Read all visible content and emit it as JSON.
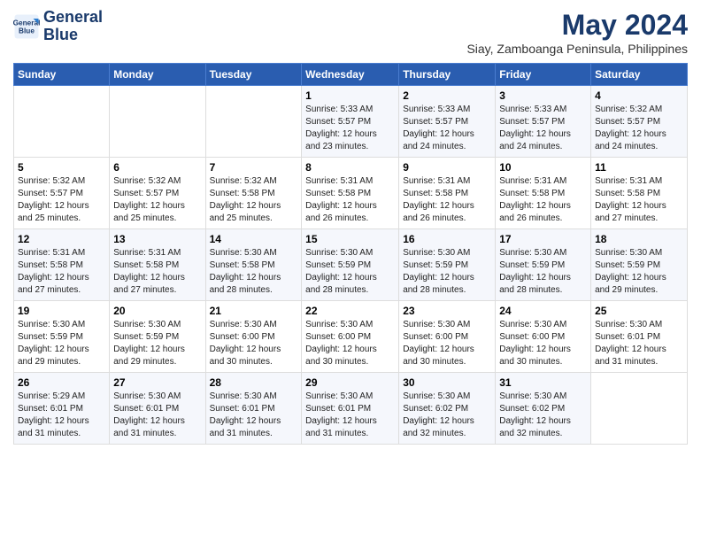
{
  "header": {
    "logo_line1": "General",
    "logo_line2": "Blue",
    "month_year": "May 2024",
    "location": "Siay, Zamboanga Peninsula, Philippines"
  },
  "days_of_week": [
    "Sunday",
    "Monday",
    "Tuesday",
    "Wednesday",
    "Thursday",
    "Friday",
    "Saturday"
  ],
  "weeks": [
    [
      {
        "day": "",
        "content": ""
      },
      {
        "day": "",
        "content": ""
      },
      {
        "day": "",
        "content": ""
      },
      {
        "day": "1",
        "content": "Sunrise: 5:33 AM\nSunset: 5:57 PM\nDaylight: 12 hours\nand 23 minutes."
      },
      {
        "day": "2",
        "content": "Sunrise: 5:33 AM\nSunset: 5:57 PM\nDaylight: 12 hours\nand 24 minutes."
      },
      {
        "day": "3",
        "content": "Sunrise: 5:33 AM\nSunset: 5:57 PM\nDaylight: 12 hours\nand 24 minutes."
      },
      {
        "day": "4",
        "content": "Sunrise: 5:32 AM\nSunset: 5:57 PM\nDaylight: 12 hours\nand 24 minutes."
      }
    ],
    [
      {
        "day": "5",
        "content": "Sunrise: 5:32 AM\nSunset: 5:57 PM\nDaylight: 12 hours\nand 25 minutes."
      },
      {
        "day": "6",
        "content": "Sunrise: 5:32 AM\nSunset: 5:57 PM\nDaylight: 12 hours\nand 25 minutes."
      },
      {
        "day": "7",
        "content": "Sunrise: 5:32 AM\nSunset: 5:58 PM\nDaylight: 12 hours\nand 25 minutes."
      },
      {
        "day": "8",
        "content": "Sunrise: 5:31 AM\nSunset: 5:58 PM\nDaylight: 12 hours\nand 26 minutes."
      },
      {
        "day": "9",
        "content": "Sunrise: 5:31 AM\nSunset: 5:58 PM\nDaylight: 12 hours\nand 26 minutes."
      },
      {
        "day": "10",
        "content": "Sunrise: 5:31 AM\nSunset: 5:58 PM\nDaylight: 12 hours\nand 26 minutes."
      },
      {
        "day": "11",
        "content": "Sunrise: 5:31 AM\nSunset: 5:58 PM\nDaylight: 12 hours\nand 27 minutes."
      }
    ],
    [
      {
        "day": "12",
        "content": "Sunrise: 5:31 AM\nSunset: 5:58 PM\nDaylight: 12 hours\nand 27 minutes."
      },
      {
        "day": "13",
        "content": "Sunrise: 5:31 AM\nSunset: 5:58 PM\nDaylight: 12 hours\nand 27 minutes."
      },
      {
        "day": "14",
        "content": "Sunrise: 5:30 AM\nSunset: 5:58 PM\nDaylight: 12 hours\nand 28 minutes."
      },
      {
        "day": "15",
        "content": "Sunrise: 5:30 AM\nSunset: 5:59 PM\nDaylight: 12 hours\nand 28 minutes."
      },
      {
        "day": "16",
        "content": "Sunrise: 5:30 AM\nSunset: 5:59 PM\nDaylight: 12 hours\nand 28 minutes."
      },
      {
        "day": "17",
        "content": "Sunrise: 5:30 AM\nSunset: 5:59 PM\nDaylight: 12 hours\nand 28 minutes."
      },
      {
        "day": "18",
        "content": "Sunrise: 5:30 AM\nSunset: 5:59 PM\nDaylight: 12 hours\nand 29 minutes."
      }
    ],
    [
      {
        "day": "19",
        "content": "Sunrise: 5:30 AM\nSunset: 5:59 PM\nDaylight: 12 hours\nand 29 minutes."
      },
      {
        "day": "20",
        "content": "Sunrise: 5:30 AM\nSunset: 5:59 PM\nDaylight: 12 hours\nand 29 minutes."
      },
      {
        "day": "21",
        "content": "Sunrise: 5:30 AM\nSunset: 6:00 PM\nDaylight: 12 hours\nand 30 minutes."
      },
      {
        "day": "22",
        "content": "Sunrise: 5:30 AM\nSunset: 6:00 PM\nDaylight: 12 hours\nand 30 minutes."
      },
      {
        "day": "23",
        "content": "Sunrise: 5:30 AM\nSunset: 6:00 PM\nDaylight: 12 hours\nand 30 minutes."
      },
      {
        "day": "24",
        "content": "Sunrise: 5:30 AM\nSunset: 6:00 PM\nDaylight: 12 hours\nand 30 minutes."
      },
      {
        "day": "25",
        "content": "Sunrise: 5:30 AM\nSunset: 6:01 PM\nDaylight: 12 hours\nand 31 minutes."
      }
    ],
    [
      {
        "day": "26",
        "content": "Sunrise: 5:29 AM\nSunset: 6:01 PM\nDaylight: 12 hours\nand 31 minutes."
      },
      {
        "day": "27",
        "content": "Sunrise: 5:30 AM\nSunset: 6:01 PM\nDaylight: 12 hours\nand 31 minutes."
      },
      {
        "day": "28",
        "content": "Sunrise: 5:30 AM\nSunset: 6:01 PM\nDaylight: 12 hours\nand 31 minutes."
      },
      {
        "day": "29",
        "content": "Sunrise: 5:30 AM\nSunset: 6:01 PM\nDaylight: 12 hours\nand 31 minutes."
      },
      {
        "day": "30",
        "content": "Sunrise: 5:30 AM\nSunset: 6:02 PM\nDaylight: 12 hours\nand 32 minutes."
      },
      {
        "day": "31",
        "content": "Sunrise: 5:30 AM\nSunset: 6:02 PM\nDaylight: 12 hours\nand 32 minutes."
      },
      {
        "day": "",
        "content": ""
      }
    ]
  ]
}
